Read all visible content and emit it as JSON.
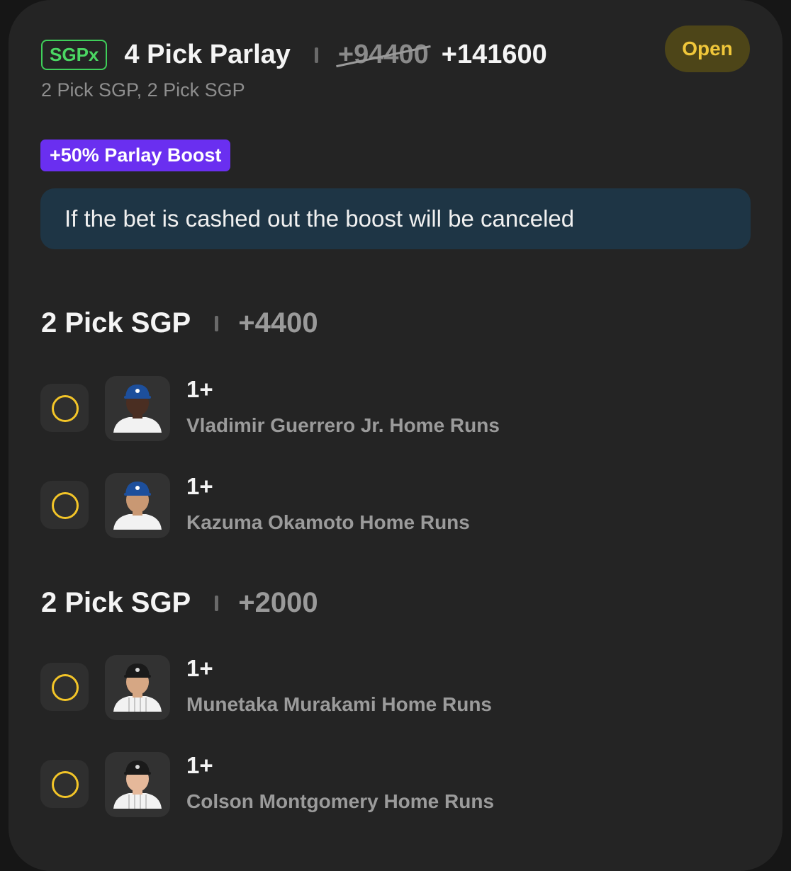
{
  "bet": {
    "badge": "SGPx",
    "title": "4 Pick Parlay",
    "original_odds": "+94400",
    "boosted_odds": "+141600",
    "status": "Open",
    "subtitle": "2 Pick SGP, 2 Pick SGP"
  },
  "boost": {
    "label": "+50% Parlay Boost",
    "notice": "If the bet is cashed out the boost will be canceled"
  },
  "groups": [
    {
      "title": "2 Pick SGP",
      "odds": "+4400",
      "legs": [
        {
          "line": "1+",
          "market": "Vladimir Guerrero Jr. Home Runs",
          "team": "blue-jays",
          "skin": "#4a2e22"
        },
        {
          "line": "1+",
          "market": "Kazuma Okamoto Home Runs",
          "team": "blue-jays",
          "skin": "#c99873"
        }
      ]
    },
    {
      "title": "2 Pick SGP",
      "odds": "+2000",
      "legs": [
        {
          "line": "1+",
          "market": "Munetaka Murakami Home Runs",
          "team": "white-sox",
          "skin": "#d6a784"
        },
        {
          "line": "1+",
          "market": "Colson Montgomery Home Runs",
          "team": "white-sox",
          "skin": "#e5b89a"
        }
      ]
    }
  ],
  "colors": {
    "sgpx_green": "#4bd763",
    "open_yellow": "#f0c73a",
    "boost_purple": "#6a2ff0",
    "notice_bg": "#1e3545",
    "radio_yellow": "#f3c528",
    "blue_jays_cap": "#1d4f9c",
    "white_sox_cap": "#1a1a1a"
  },
  "icons": {
    "radio": "radio-unselected-icon",
    "avatar": "player-headshot"
  }
}
